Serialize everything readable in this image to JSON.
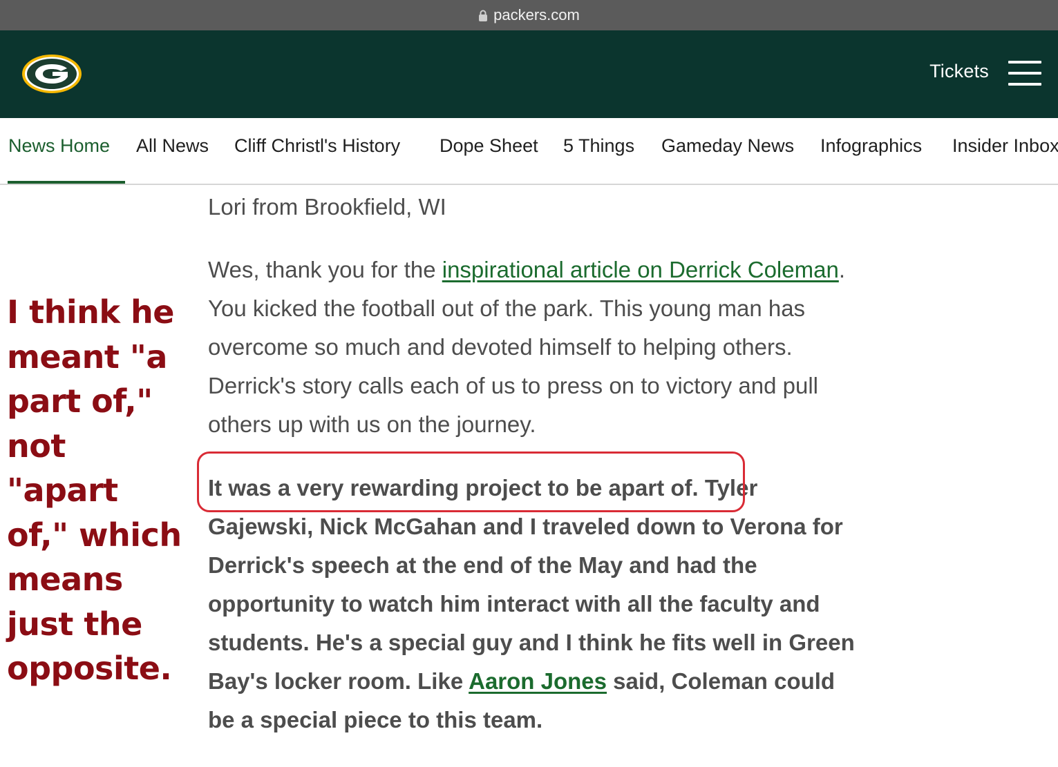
{
  "browser": {
    "url": "packers.com"
  },
  "header": {
    "tickets_label": "Tickets"
  },
  "subnav": {
    "items": [
      {
        "label": "News Home"
      },
      {
        "label": "All News"
      },
      {
        "label": "Cliff Christl's History"
      },
      {
        "label": "Dope Sheet"
      },
      {
        "label": "5 Things"
      },
      {
        "label": "Gameday News"
      },
      {
        "label": "Infographics"
      },
      {
        "label": "Insider Inbox"
      }
    ],
    "active": "News Home"
  },
  "article": {
    "byline": "Lori from Brookfield, WI",
    "para1": {
      "intro": "Wes, thank you for the ",
      "link_text": "inspirational article on Derrick Coleman",
      "rest": ". You kicked the football out of the park. This young man has overcome so much and devoted himself to helping others. Derrick's story calls each of us to press on to victory and pull others up with us on the journey."
    },
    "para2": {
      "highlighted": "It was a very rewarding project to be apart of.",
      "middle": " Tyler Gajewski, Nick McGahan and I traveled down to Verona for Derrick's speech at the end of the May and had the opportunity to watch him interact with all the faculty and students. He's a special guy and I think he fits well in Green Bay's locker room. Like ",
      "link_text": "Aaron Jones",
      "end": " said, Coleman could be a special piece to this team."
    }
  },
  "annotation": {
    "text": "I think he meant \"a part of,\" not \"apart of,\" which means just the opposite."
  },
  "colors": {
    "header_bg": "#0b352e",
    "link": "#1b6b2e",
    "annotation": "#8b0d14",
    "highlight_box": "#d92b35"
  }
}
